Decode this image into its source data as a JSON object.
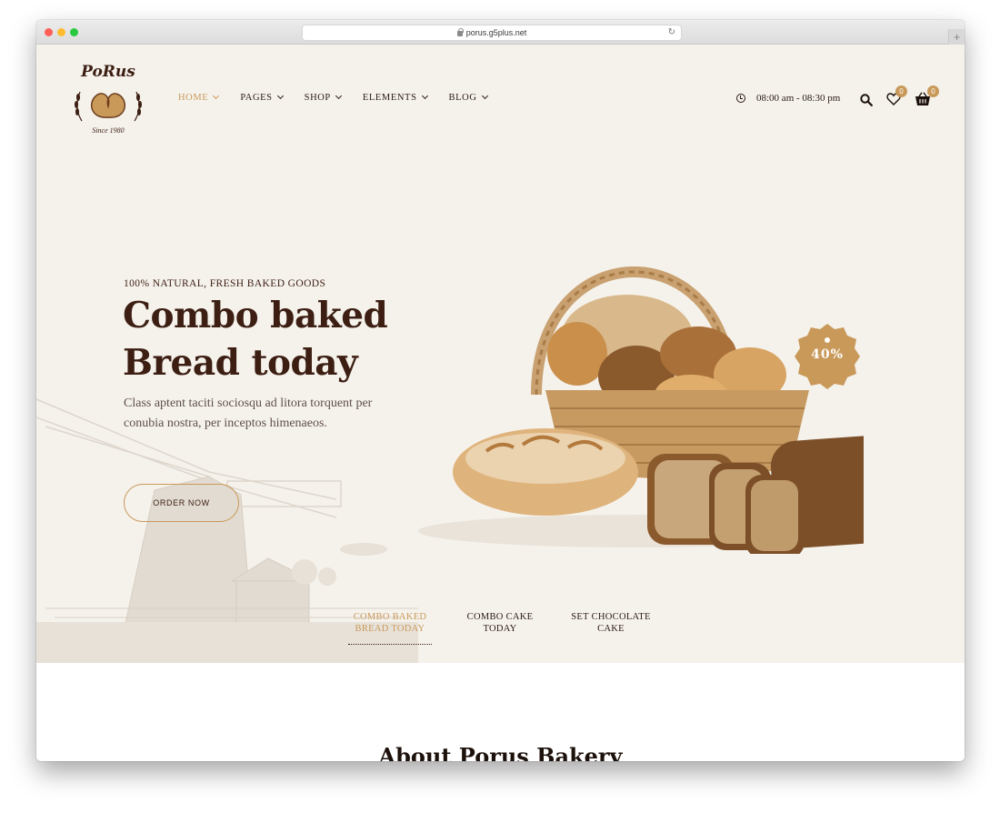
{
  "browser": {
    "url": "porus.g5plus.net"
  },
  "header": {
    "logo": {
      "title": "PoRus",
      "since": "Since 1980"
    },
    "nav": [
      {
        "label": "HOME",
        "active": true
      },
      {
        "label": "PAGES",
        "active": false
      },
      {
        "label": "SHOP",
        "active": false
      },
      {
        "label": "ELEMENTS",
        "active": false
      },
      {
        "label": "BLOG",
        "active": false
      }
    ],
    "hours": "08:00 am - 08:30 pm",
    "wishlist_count": "0",
    "cart_count": "0"
  },
  "hero": {
    "eyebrow": "100% NATURAL, FRESH BAKED GOODS",
    "headline_line1": "Combo baked",
    "headline_line2": "Bread today",
    "description": "Class aptent taciti sociosqu ad litora torquent per conubia nostra, per inceptos himenaeos.",
    "cta": "ORDER NOW",
    "discount": "40%"
  },
  "slide_tabs": [
    {
      "line1": "COMBO BAKED",
      "line2": "BREAD TODAY",
      "active": true
    },
    {
      "line1": "COMBO CAKE",
      "line2": "TODAY",
      "active": false
    },
    {
      "line1": "SET CHOCOLATE",
      "line2": "CAKE",
      "active": false
    }
  ],
  "about": {
    "title": "About Porus Bakery"
  },
  "colors": {
    "accent": "#c9995a",
    "brand_dark": "#3c1e12",
    "hero_background": "#f5f2ec"
  },
  "icons": [
    "lock-icon",
    "reload-icon",
    "clock-icon",
    "search-icon",
    "heart-icon",
    "cart-icon",
    "chevron-down-icon",
    "pretzel-logo-icon"
  ]
}
